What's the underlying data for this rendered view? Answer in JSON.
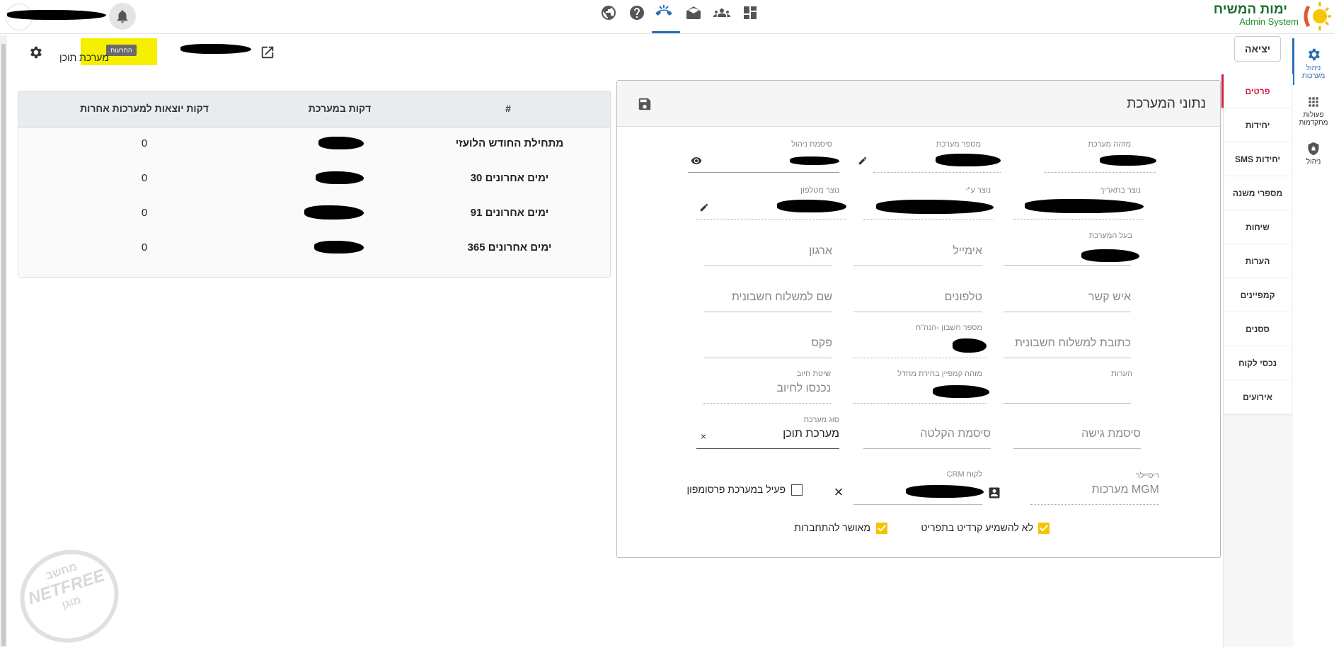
{
  "brand": {
    "title": "ימות המשיח",
    "subtitle": "Admin System"
  },
  "header": {
    "tooltip": "התרעות",
    "system_name_partial": "מערכת תוכן",
    "exit_label": "יציאה"
  },
  "left_rail": [
    {
      "label": "ניהול מערכות",
      "icon": "gear-icon"
    },
    {
      "label": "פעולות מתקדמות",
      "icon": "apps-grid-icon"
    },
    {
      "label": "ניהול",
      "icon": "lock-shield-icon"
    }
  ],
  "tabs": [
    {
      "label": "פרטים",
      "active": true
    },
    {
      "label": "יחידות"
    },
    {
      "label": "יחידות SMS"
    },
    {
      "label": "מספרי משנה"
    },
    {
      "label": "שיחות"
    },
    {
      "label": "הערות"
    },
    {
      "label": "קמפיינים"
    },
    {
      "label": "ססנים"
    },
    {
      "label": "נכסי לקוח"
    },
    {
      "label": "אירועים"
    }
  ],
  "form": {
    "title": "נתוני המערכת",
    "labels": {
      "system_id": "מזהה מערכת",
      "system_number": "מספר מערכת",
      "admin_password": "סיסמת ניהול",
      "created_date": "נוצר בתאריך",
      "created_by": "נוצר ע\"י",
      "created_from_phone": "נוצר מטלפון",
      "owner": "בעל המערכת",
      "account_number": "מספר חשבון -הנה\"ח",
      "notes": "הערות",
      "campaign_id": "מזהה קמפיין בחירת מחדל",
      "billing_method": "שיטת חיוב",
      "system_type": "סוג מערכת",
      "reseller": "ריסיילר",
      "crm_client": "לקוח CRM"
    },
    "placeholders": {
      "email": "אימייל",
      "organization": "ארגון",
      "contact": "איש קשר",
      "phones": "טלפונים",
      "billing_name": "שם למשלוח חשבונית",
      "billing_address": "כתובת למשלוח חשבונית",
      "fax": "פקס",
      "access_password": "סיסמת גישה",
      "recording_password": "סיסמת הקלטה"
    },
    "values": {
      "billing_method": "נכנסו לחיוב",
      "system_type": "מערכת תוכן",
      "reseller": "MGM מערכות"
    },
    "checkboxes": {
      "promo_active": {
        "label": "פעיל במערכת פרסומפון",
        "checked": false
      },
      "no_credit": {
        "label": "לא להשמיע קרדיט בתפריט",
        "checked": true
      },
      "login_approved": {
        "label": "מאושר להתחברות",
        "checked": true
      }
    }
  },
  "minutes_table": {
    "headers": [
      "#",
      "דקות במערכת",
      "דקות יוצאות למערכות אחרות"
    ],
    "rows": [
      {
        "period": "מתחילת החודש הלועזי",
        "outgoing": "0"
      },
      {
        "period": "30 ימים אחרונים",
        "outgoing": "0"
      },
      {
        "period": "91 ימים אחרונים",
        "outgoing": "0"
      },
      {
        "period": "365 ימים אחרונים",
        "outgoing": "0"
      }
    ]
  },
  "watermark": {
    "top": "מחשב",
    "middle": "NETFREE",
    "bottom": "מוגן"
  }
}
